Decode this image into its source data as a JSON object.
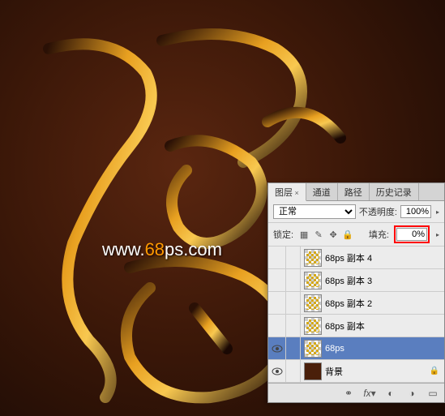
{
  "watermark": {
    "prefix": "www.",
    "highlight": "68",
    "suffix": "ps.com"
  },
  "panel": {
    "tabs": {
      "layers": "图层",
      "channels": "通道",
      "paths": "路径",
      "history": "历史记录"
    },
    "blend_mode": "正常",
    "opacity_label": "不透明度:",
    "opacity_value": "100%",
    "lock_label": "锁定:",
    "fill_label": "填充:",
    "fill_value": "0%",
    "layers": [
      {
        "name": "68ps 副本 4",
        "visible": false,
        "selected": false,
        "thumb": "pattern"
      },
      {
        "name": "68ps 副本 3",
        "visible": false,
        "selected": false,
        "thumb": "pattern"
      },
      {
        "name": "68ps 副本 2",
        "visible": false,
        "selected": false,
        "thumb": "pattern"
      },
      {
        "name": "68ps 副本",
        "visible": false,
        "selected": false,
        "thumb": "pattern"
      },
      {
        "name": "68ps",
        "visible": true,
        "selected": true,
        "thumb": "pattern"
      },
      {
        "name": "背景",
        "visible": true,
        "selected": false,
        "thumb": "bg",
        "locked": true
      }
    ],
    "footer_link": "链接"
  }
}
